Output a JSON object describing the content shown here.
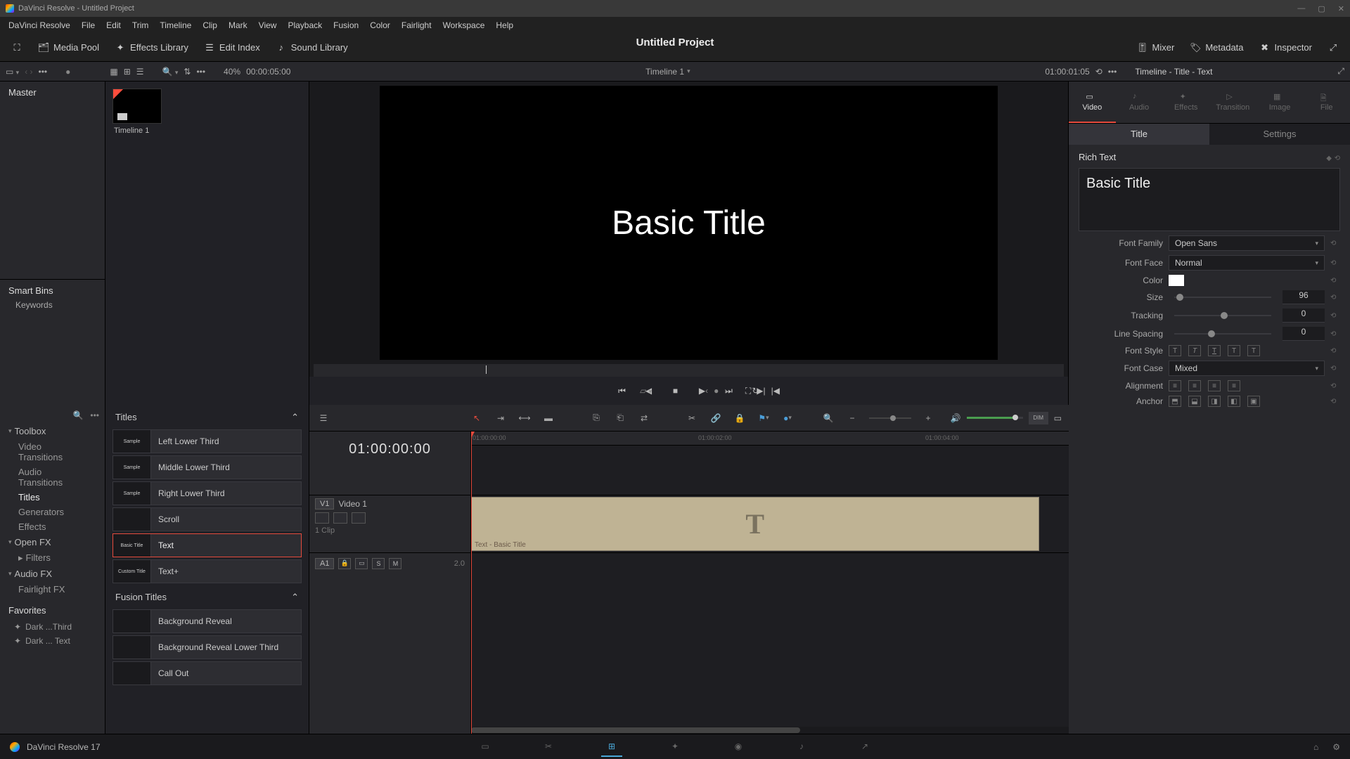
{
  "titlebar": "DaVinci Resolve - Untitled Project",
  "menu": [
    "DaVinci Resolve",
    "File",
    "Edit",
    "Trim",
    "Timeline",
    "Clip",
    "Mark",
    "View",
    "Playback",
    "Fusion",
    "Color",
    "Fairlight",
    "Workspace",
    "Help"
  ],
  "toolbar": {
    "mediapool": "Media Pool",
    "fxlib": "Effects Library",
    "editindex": "Edit Index",
    "soundlib": "Sound Library",
    "mixer": "Mixer",
    "metadata": "Metadata",
    "inspector": "Inspector"
  },
  "project_title": "Untitled Project",
  "sec": {
    "zoom": "40%",
    "dur": "00:00:05:00",
    "timeline_name": "Timeline 1",
    "tc": "01:00:01:05",
    "insp_path": "Timeline - Title - Text"
  },
  "mediapool": {
    "master": "Master",
    "smartbins": "Smart Bins",
    "keywords": "Keywords",
    "clip": "Timeline 1"
  },
  "viewer": {
    "text": "Basic Title"
  },
  "fx": {
    "toolbox": "Toolbox",
    "cats": {
      "vt": "Video Transitions",
      "at": "Audio Transitions",
      "titles": "Titles",
      "gen": "Generators",
      "eff": "Effects"
    },
    "openfx": "Open FX",
    "filters": "Filters",
    "audiofx": "Audio FX",
    "fairlight": "Fairlight FX",
    "favorites": "Favorites",
    "fav1": "Dark ...Third",
    "fav2": "Dark ... Text",
    "titles_hdr": "Titles",
    "items": [
      "Left Lower Third",
      "Middle Lower Third",
      "Right Lower Third",
      "Scroll",
      "Text",
      "Text+"
    ],
    "thumbs": [
      "Sample",
      "Sample",
      "Sample",
      "",
      "Basic Title",
      "Custom Title"
    ],
    "fusion_hdr": "Fusion Titles",
    "fusion_items": [
      "Background Reveal",
      "Background Reveal Lower Third",
      "Call Out"
    ]
  },
  "inspector": {
    "tabs": [
      "Video",
      "Audio",
      "Effects",
      "Transition",
      "Image",
      "File"
    ],
    "subtabs": [
      "Title",
      "Settings"
    ],
    "section": "Rich Text",
    "text_value": "Basic Title",
    "font_family_label": "Font Family",
    "font_family": "Open Sans",
    "font_face_label": "Font Face",
    "font_face": "Normal",
    "color_label": "Color",
    "size_label": "Size",
    "size": "96",
    "tracking_label": "Tracking",
    "tracking": "0",
    "linespacing_label": "Line Spacing",
    "linespacing": "0",
    "fontstyle_label": "Font Style",
    "fontcase_label": "Font Case",
    "fontcase": "Mixed",
    "alignment_label": "Alignment",
    "anchor_label": "Anchor"
  },
  "timeline": {
    "tc": "01:00:00:00",
    "v1_tag": "V1",
    "v1_name": "Video 1",
    "v1_meta": "1 Clip",
    "a1_tag": "A1",
    "a1_meta": "2.0",
    "clip_name": "Text - Basic Title",
    "ruler": [
      "01:00:00:00",
      "01:00:02:00",
      "01:00:04:00"
    ],
    "dim": "DIM"
  },
  "bottom": {
    "app": "DaVinci Resolve 17"
  }
}
